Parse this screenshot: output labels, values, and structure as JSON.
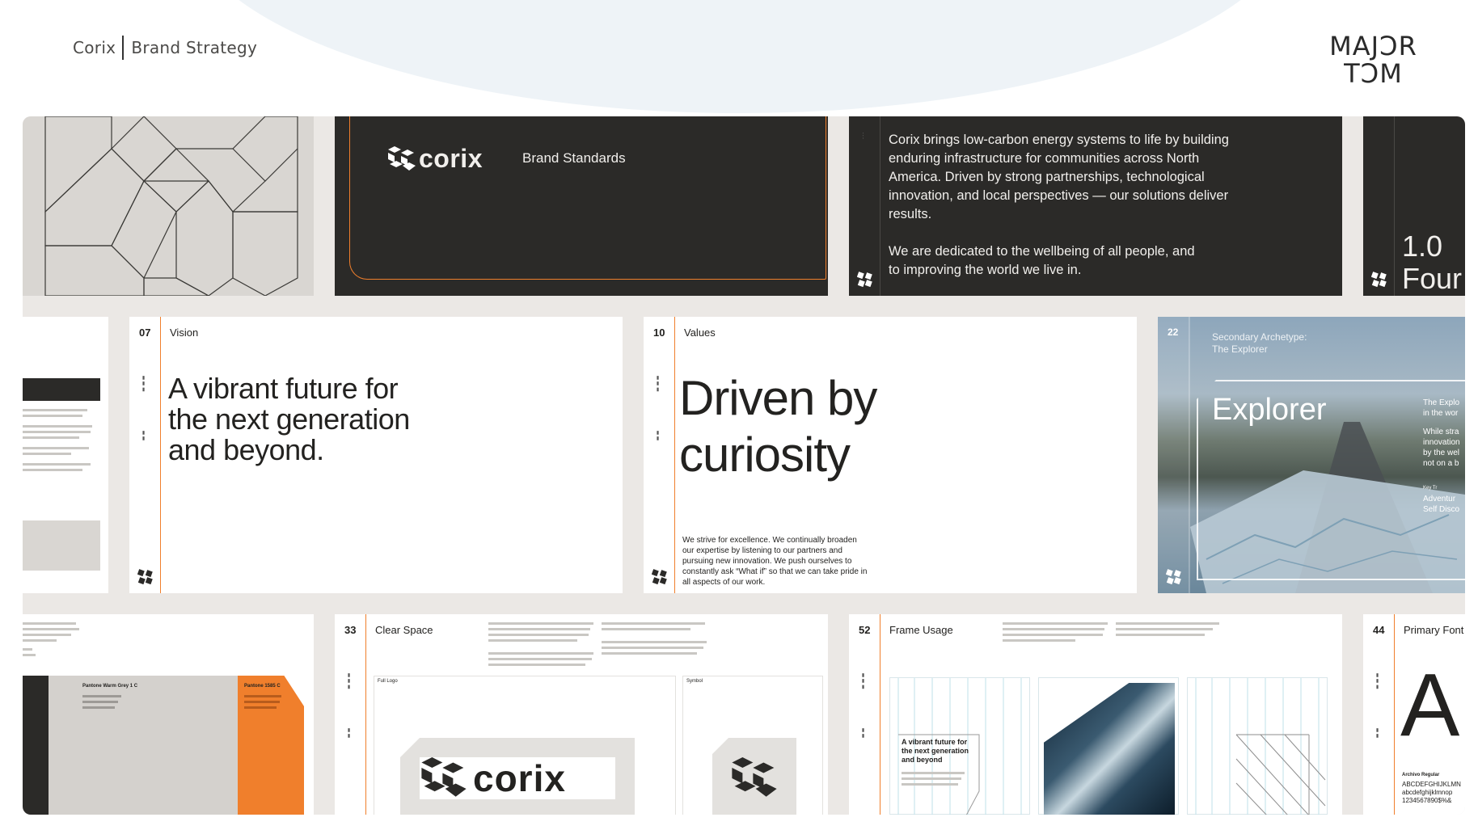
{
  "header": {
    "brand": "Corix",
    "title": "Brand Strategy",
    "agency_logo_line1": "MAJϽR",
    "agency_logo_line2": "TϽM"
  },
  "row1": {
    "cover": {
      "wordmark": "corix",
      "subtitle": "Brand Standards"
    },
    "mission": {
      "paragraph1": "Corix brings low-carbon energy systems to life by building enduring infrastructure for communities across North America. Driven by strong partnerships, technological innovation, and local perspectives — our solutions deliver results.",
      "paragraph2": "We are dedicated to the wellbeing of all people, and to improving the world we live in."
    },
    "foundation": {
      "number": "1.0",
      "title": "Four"
    }
  },
  "row2": {
    "vision": {
      "page": "07",
      "label": "Vision",
      "headline": "A vibrant future for the next generation and beyond."
    },
    "values": {
      "page": "10",
      "label": "Values",
      "headline": "Driven by curiosity",
      "body": "We strive for excellence. We continually broaden our expertise by listening to our partners and pursuing new innovation. We push ourselves to constantly ask “What if” so that we can take pride in all aspects of our work."
    },
    "archetype": {
      "page": "22",
      "caption_line1": "Secondary Archetype:",
      "caption_line2": "The Explorer",
      "headline": "Explorer",
      "side_text1": "The Explo",
      "side_text2": "in the wor",
      "side_text3": "While stra",
      "side_text4": "innovation",
      "side_text5": "by the wel",
      "side_text6": "not on a b",
      "side_text7": "Key Tr",
      "side_text8": "Adventur",
      "side_text9": "Self Disco"
    }
  },
  "row3": {
    "palette": {
      "swatch1": "Pantone Warm Grey 1 C",
      "swatch2": "Pantone 1585 C"
    },
    "clear_space": {
      "page": "33",
      "label": "Clear Space",
      "wordmark": "corix",
      "box1": "Full Logo",
      "box2": "Symbol"
    },
    "frame_usage": {
      "page": "52",
      "label": "Frame Usage",
      "frame_headline": "A vibrant future for the next generation and beyond"
    },
    "primary_font": {
      "page": "44",
      "label": "Primary Font",
      "glyph": "A",
      "font_name": "Archivo Regular",
      "abc": "ABCDEFGHIJKLMN",
      "abc_lower": "abcdefghijklmnop",
      "digits": "1234567890$%&"
    }
  },
  "colors": {
    "accent": "#f07f2c",
    "dark": "#2b2a28",
    "board": "#ebe8e5",
    "warm_grey": "#d4d1cd"
  }
}
